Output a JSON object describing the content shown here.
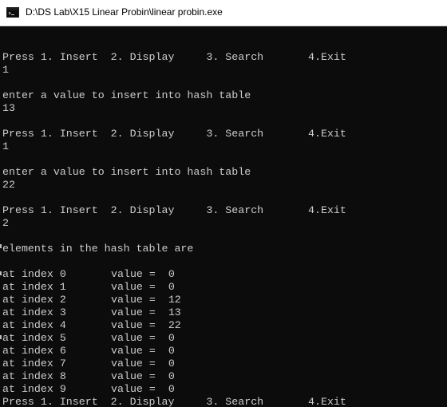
{
  "window": {
    "title": "D:\\DS Lab\\X15 Linear Probin\\linear probin.exe"
  },
  "console": {
    "lines": [
      "",
      "Press 1. Insert  2. Display     3. Search       4.Exit",
      "1",
      "",
      "enter a value to insert into hash table",
      "13",
      "",
      "Press 1. Insert  2. Display     3. Search       4.Exit",
      "1",
      "",
      "enter a value to insert into hash table",
      "22",
      "",
      "Press 1. Insert  2. Display     3. Search       4.Exit",
      "2",
      "",
      "elements in the hash table are",
      ""
    ],
    "hash_rows": [
      {
        "index": "at index 0",
        "value": "value =  0"
      },
      {
        "index": "at index 1",
        "value": "value =  0"
      },
      {
        "index": "at index 2",
        "value": "value =  12"
      },
      {
        "index": "at index 3",
        "value": "value =  13"
      },
      {
        "index": "at index 4",
        "value": "value =  22"
      },
      {
        "index": "at index 5",
        "value": "value =  0"
      },
      {
        "index": "at index 6",
        "value": "value =  0"
      },
      {
        "index": "at index 7",
        "value": "value =  0"
      },
      {
        "index": "at index 8",
        "value": "value =  0"
      },
      {
        "index": "at index 9",
        "value": "value =  0"
      }
    ],
    "final_prompt": "Press 1. Insert  2. Display     3. Search       4.Exit"
  },
  "colors": {
    "background": "#0c0c0c",
    "text": "#cccccc",
    "titlebar": "#ffffff"
  }
}
